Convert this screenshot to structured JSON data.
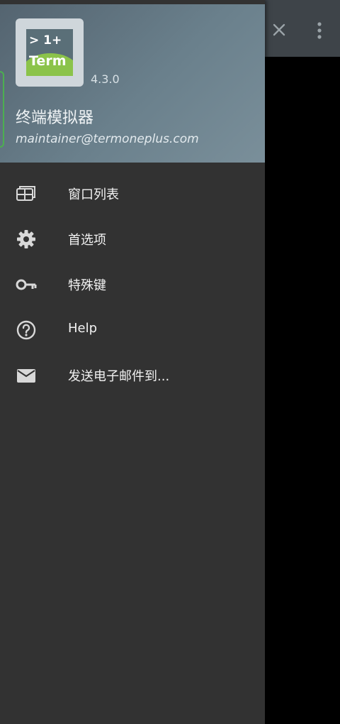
{
  "app": {
    "name_logo_line1": "> 1+",
    "name_logo_line2": "Term",
    "version": "4.3.0",
    "title": "终端模拟器",
    "email": "maintainer@termoneplus.com"
  },
  "toolbar": {
    "close_icon": "close-icon",
    "more_icon": "more-vert-icon"
  },
  "menu": {
    "items": [
      {
        "label": "窗口列表",
        "icon": "windows-list-icon"
      },
      {
        "label": "首选项",
        "icon": "gear-icon"
      },
      {
        "label": "特殊键",
        "icon": "key-icon"
      },
      {
        "label": "Help",
        "icon": "help-circle-icon"
      },
      {
        "label": "发送电子邮件到...",
        "icon": "mail-icon"
      }
    ]
  },
  "colors": {
    "drawer_bg": "#323232",
    "header_gradient_start": "#546470",
    "header_gradient_end": "#7a8f9a",
    "accent_green": "#8bc34a",
    "toolbar_bg": "#3e4449"
  }
}
